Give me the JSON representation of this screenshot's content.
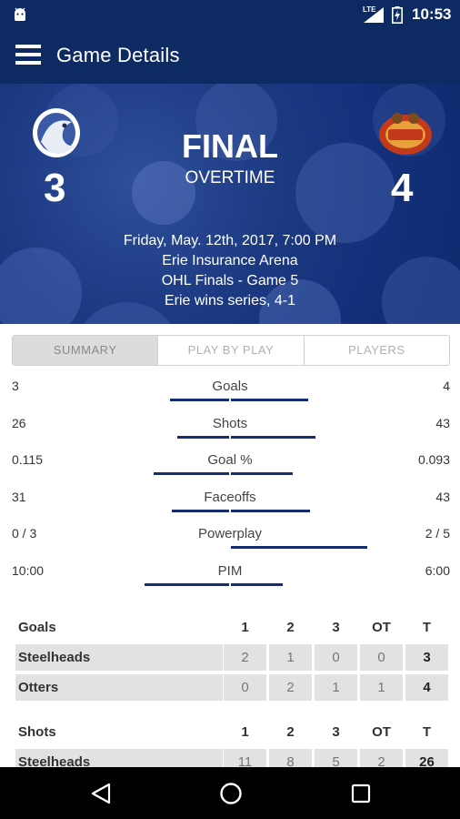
{
  "status_bar": {
    "network": "LTE",
    "time": "10:53"
  },
  "app_bar": {
    "title": "Game Details"
  },
  "game": {
    "status": "FINAL",
    "period": "OVERTIME",
    "home_score": "3",
    "away_score": "4",
    "date": "Friday, May. 12th, 2017, 7:00 PM",
    "venue": "Erie Insurance Arena",
    "series_game": "OHL Finals - Game 5",
    "series_result": "Erie wins series, 4-1"
  },
  "tabs": [
    "SUMMARY",
    "PLAY BY PLAY",
    "PLAYERS"
  ],
  "stats": [
    {
      "label": "Goals",
      "left": "3",
      "right": "4",
      "left_frac": 0.43,
      "right_frac": 0.57
    },
    {
      "label": "Shots",
      "left": "26",
      "right": "43",
      "left_frac": 0.38,
      "right_frac": 0.62
    },
    {
      "label": "Goal %",
      "left": "0.115",
      "right": "0.093",
      "left_frac": 0.55,
      "right_frac": 0.45
    },
    {
      "label": "Faceoffs",
      "left": "31",
      "right": "43",
      "left_frac": 0.42,
      "right_frac": 0.58
    },
    {
      "label": "Powerplay",
      "left": "0 / 3",
      "right": "2 / 5",
      "left_frac": 0.0,
      "right_frac": 1.0
    },
    {
      "label": "PIM",
      "left": "10:00",
      "right": "6:00",
      "left_frac": 0.62,
      "right_frac": 0.38
    }
  ],
  "goals_table": {
    "title": "Goals",
    "columns": [
      "1",
      "2",
      "3",
      "OT",
      "T"
    ],
    "rows": [
      {
        "team": "Steelheads",
        "values": [
          "2",
          "1",
          "0",
          "0"
        ],
        "total": "3"
      },
      {
        "team": "Otters",
        "values": [
          "0",
          "2",
          "1",
          "1"
        ],
        "total": "4"
      }
    ]
  },
  "shots_table": {
    "title": "Shots",
    "columns": [
      "1",
      "2",
      "3",
      "OT",
      "T"
    ],
    "rows": [
      {
        "team": "Steelheads",
        "values": [
          "11",
          "8",
          "5",
          "2"
        ],
        "total": "26"
      }
    ]
  },
  "colors": {
    "primary": "#0d2a63",
    "bar": "#152d73"
  }
}
